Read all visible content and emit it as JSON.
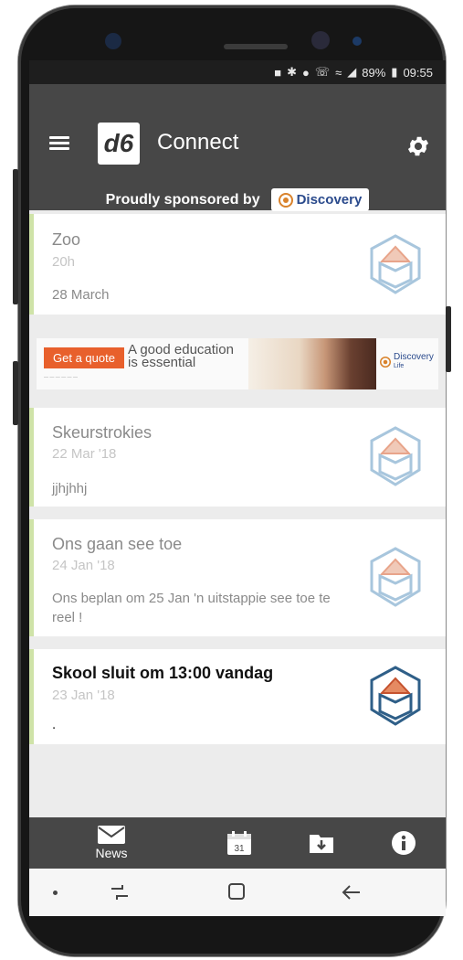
{
  "status": {
    "battery": "89%",
    "time": "09:55"
  },
  "header": {
    "logo": "d6",
    "title": "Connect",
    "sponsor_text": "Proudly sponsored by",
    "sponsor_name": "Discovery"
  },
  "ad": {
    "button": "Get a quote",
    "line1": "A good education",
    "line2": "is essential",
    "brand": "Discovery",
    "brand_sub": "Life"
  },
  "feed": [
    {
      "title": "Zoo",
      "date": "20h",
      "body": "28 March"
    },
    {
      "title": "Skeurstrokies",
      "date": "22 Mar '18",
      "body": "jjhjhhj"
    },
    {
      "title": "Ons gaan see toe",
      "date": "24 Jan '18",
      "body": "Ons beplan om 25 Jan 'n uitstappie see toe te reel !"
    },
    {
      "title": "Skool sluit om 13:00 vandag",
      "date": "23 Jan '18",
      "body": "."
    }
  ],
  "bottom_nav": {
    "news": "News",
    "calendar_day": "31"
  },
  "colors": {
    "appbar": "#474747",
    "accent_border": "#cfe3a8",
    "ad_button": "#e8602c"
  }
}
